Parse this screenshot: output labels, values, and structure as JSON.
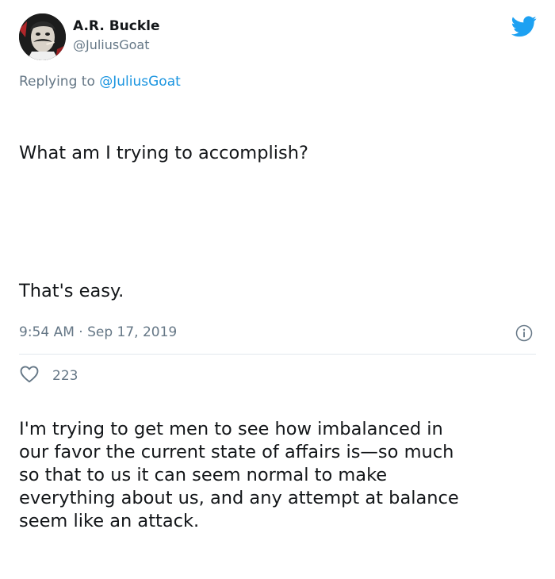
{
  "author": {
    "name": "A.R. Buckle",
    "handle": "@JuliusGoat"
  },
  "reply": {
    "prefix": "Replying to ",
    "mention": "@JuliusGoat"
  },
  "tweet": {
    "paragraphs": [
      "What am I trying to accomplish?",
      "That's easy.",
      "I'm trying to get men to see how imbalanced in\nour favor the current state of affairs is—so much\nso that to us it can seem normal to make\neverything about us, and any attempt at balance\nseem like an attack."
    ],
    "timestamp": "9:54 AM · Sep 17, 2019"
  },
  "stats": {
    "likes": "223"
  },
  "colors": {
    "accent": "#1da1f2",
    "text": "#14171a",
    "muted": "#657786",
    "divider": "#e1e8ed",
    "like_icon": "#e0245e"
  },
  "icons": {
    "brand": "twitter-bird-icon",
    "info": "info-circle-icon",
    "like": "heart-outline-icon"
  }
}
